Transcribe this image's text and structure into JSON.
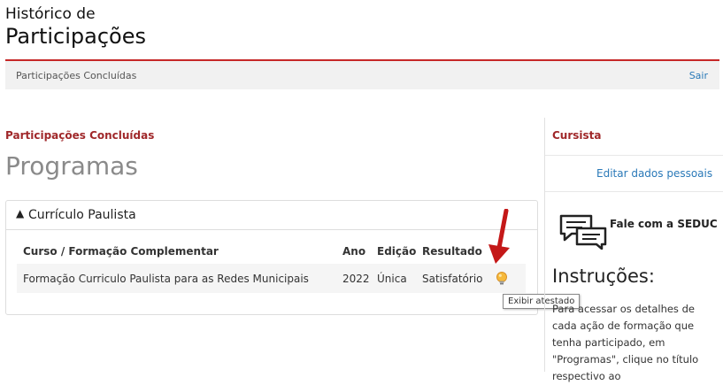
{
  "header": {
    "title_line1": "Histórico de",
    "title_line2": "Participações"
  },
  "subnav": {
    "breadcrumb": "Participações Concluídas",
    "logout_label": "Sair"
  },
  "main": {
    "section_label": "Participações Concluídas",
    "heading": "Programas",
    "panel": {
      "title": "Currículo Paulista",
      "columns": [
        "Curso / Formação Complementar",
        "Ano",
        "Edição",
        "Resultado"
      ],
      "rows": [
        {
          "course": "Formação Curriculo Paulista para as Redes Municipais",
          "year": "2022",
          "edition": "Única",
          "result": "Satisfatório",
          "action_tooltip": "Exibir atestado"
        }
      ]
    }
  },
  "sidebar": {
    "section_label": "Cursista",
    "edit_link": "Editar dados pessoais",
    "contact_label": "Fale com a SEDUC",
    "instructions_title": "Instruções:",
    "instructions_text": "Para acessar os detalhes de cada ação de formação que tenha participado, em \"Programas\", clique no título respectivo ao"
  },
  "colors": {
    "accent_red": "#c62828",
    "section_red": "#a0282a",
    "link_blue": "#2a79b8",
    "bulb_yellow": "#f6b93b"
  },
  "icons": [
    "caret-up-icon",
    "lightbulb-icon",
    "chat-bubbles-icon",
    "red-arrow-annotation"
  ]
}
